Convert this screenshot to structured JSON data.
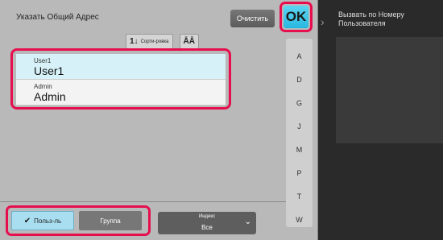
{
  "header": {
    "title": "Указать Общий Адрес",
    "clear_label": "Очистить",
    "ok_label": "OK"
  },
  "sort": {
    "sort_label": "Сорти-ровка",
    "sort_icon": "1↓",
    "az_icon": "ĀĀ"
  },
  "list": [
    {
      "sub": "User1",
      "main": "User1",
      "selected": true
    },
    {
      "sub": "Admin",
      "main": "Admin",
      "selected": false
    }
  ],
  "index_letters": [
    "A",
    "D",
    "G",
    "J",
    "M",
    "P",
    "T",
    "W"
  ],
  "sidebar": {
    "link_text_1": "Вызвать по Номеру",
    "link_text_2": "Пользователя"
  },
  "tabs": {
    "user_label": "Польз-ль",
    "group_label": "Группа"
  },
  "index_dropdown": {
    "label": "Индекс",
    "value": "Все"
  }
}
